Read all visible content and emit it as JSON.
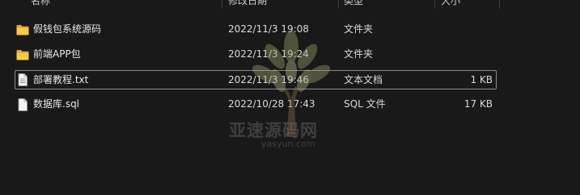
{
  "columns": {
    "name": "名称",
    "date": "修改日期",
    "type": "类型",
    "size": "大小"
  },
  "files": [
    {
      "name": "假钱包系统源码",
      "date": "2022/11/3 19:08",
      "type": "文件夹",
      "size": "",
      "icon": "folder-icon",
      "selected": false
    },
    {
      "name": "前端APP包",
      "date": "2022/11/3 19:24",
      "type": "文件夹",
      "size": "",
      "icon": "folder-icon",
      "selected": false
    },
    {
      "name": "部署教程.txt",
      "date": "2022/11/3 19:46",
      "type": "文本文档",
      "size": "1 KB",
      "icon": "text-file-icon",
      "selected": true
    },
    {
      "name": "数据库.sql",
      "date": "2022/10/28 17:43",
      "type": "SQL 文件",
      "size": "17 KB",
      "icon": "file-icon",
      "selected": false
    }
  ],
  "watermark": {
    "text": "亚速源码网",
    "url": "yasyun.com"
  },
  "colors": {
    "background": "#191919",
    "folder": "#f0c040",
    "selection_border": "#8a8a8a"
  }
}
